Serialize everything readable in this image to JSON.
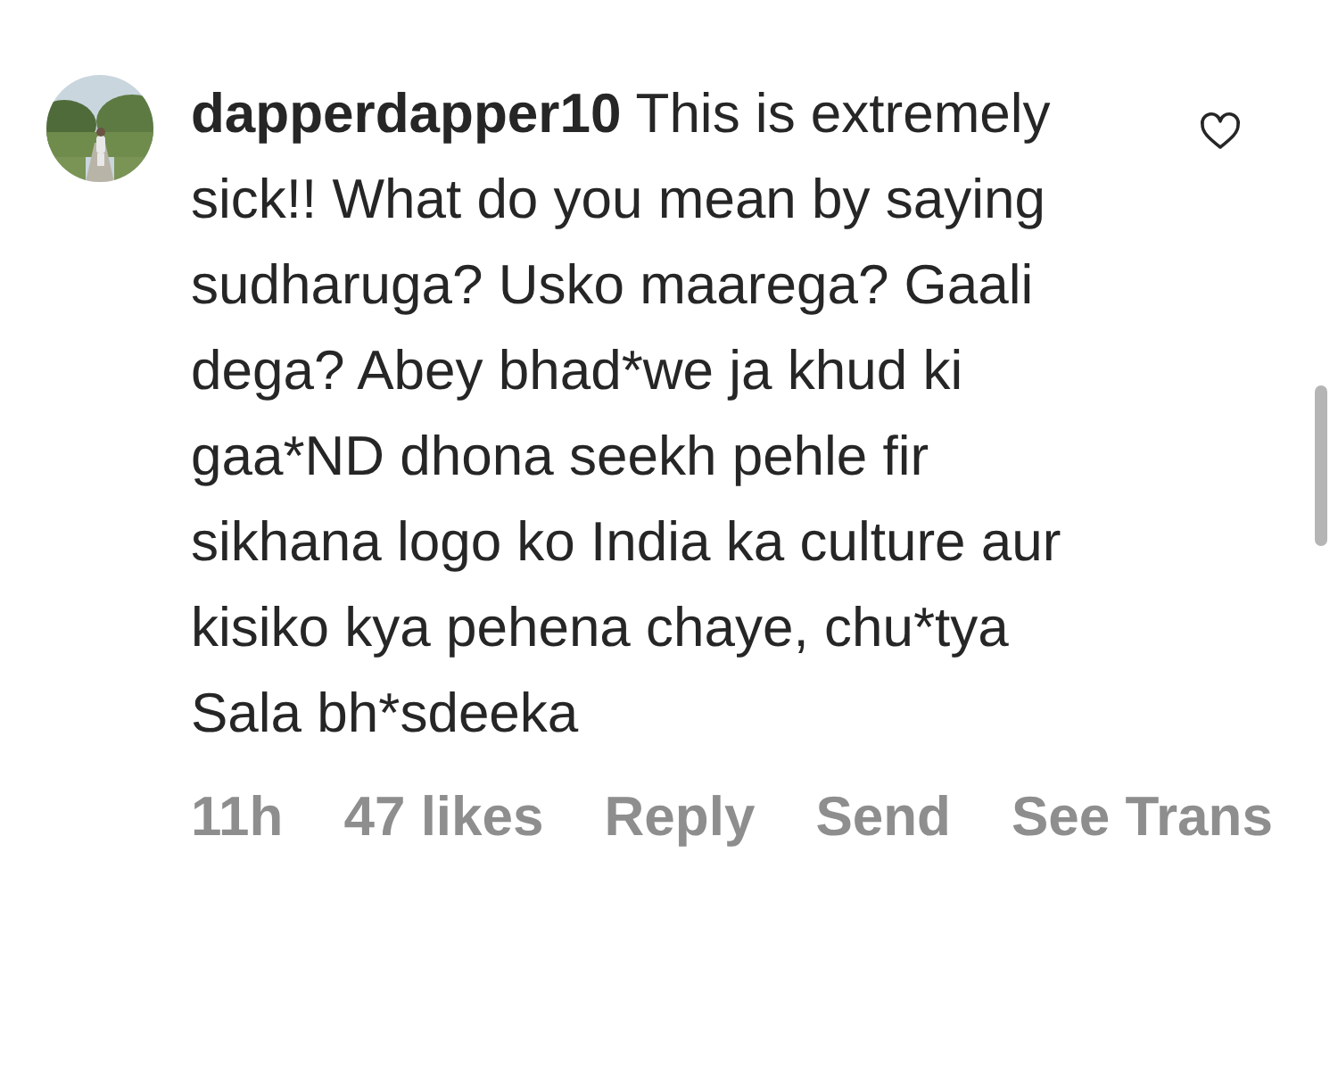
{
  "comment": {
    "text": "**dapperdapper10** This is extremely sick!! What do you mean by saying sudharuga? Usko maarega? Gaali dega? Abey bhad*we ja khud ki gaa*ND dhona seekh pehle fir sikhana logo ko India ka culture aur kisiko kya pehena chaye,  chu*tya Sala bh*sdeeka",
    "liked": false
  },
  "footer": [
    "11h",
    "47 likes",
    "Reply",
    "Send",
    "See Trans"
  ]
}
